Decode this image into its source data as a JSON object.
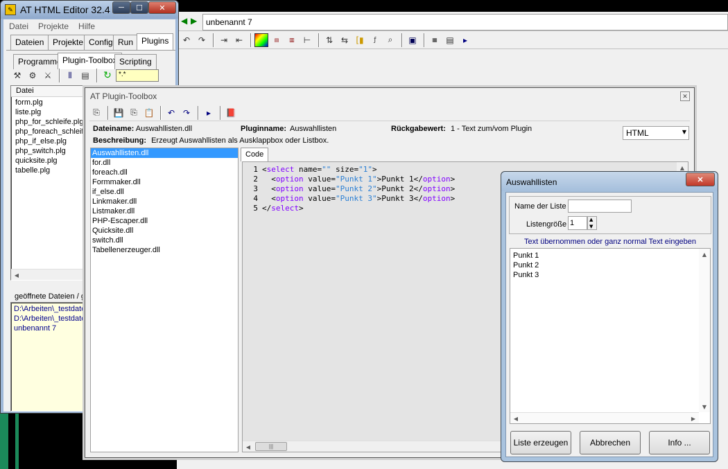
{
  "main_window": {
    "title": "AT HTML Editor 32.4",
    "menu": [
      "Datei",
      "Projekte",
      "Hilfe"
    ],
    "top_tabs": [
      "Dateien",
      "Projekte",
      "Config",
      "Run",
      "Plugins"
    ],
    "sub_tabs": [
      "Programme",
      "Plugin-Toolbox",
      "Scripting"
    ],
    "filter_value": "*.*",
    "file_column_header": "Datei",
    "files": [
      "form.plg",
      "liste.plg",
      "php_for_schleife.plg",
      "php_foreach_schleife",
      "php_if_else.plg",
      "php_switch.plg",
      "quicksite.plg",
      "tabelle.plg"
    ],
    "open_files_header": "geöffnete Dateien / g",
    "open_files": [
      "D:\\Arbeiten\\_testdaten",
      "D:\\Arbeiten\\_testdaten",
      "unbenannt 7"
    ]
  },
  "editor_bar": {
    "document_tab": "unbenannt 7",
    "icons": [
      "undo-icon",
      "redo-icon",
      "indent-icon",
      "outdent-icon",
      "color-picker-icon",
      "html-php-basic-icon",
      "code-icon",
      "tree-icon",
      "sort-icon",
      "replace-icon",
      "bracket-icon",
      "func-icon",
      "search-doc-icon",
      "window-icon",
      "asp-jsp-icon",
      "preview-icon",
      "run-icon"
    ]
  },
  "plugin_toolbox": {
    "title": "AT Plugin-Toolbox",
    "dateiname_label": "Dateiname:",
    "dateiname_value": "Auswahllisten.dll",
    "pluginname_label": "Pluginname:",
    "pluginname_value": "Auswahllisten",
    "rueckgabe_label": "Rückgabewert:",
    "rueckgabe_value": "1 - Text zum/vom Plugin",
    "format_value": "HTML",
    "beschreibung_label": "Beschreibung:",
    "beschreibung_value": "Erzeugt Auswahllisten als Ausklappbox oder Listbox.",
    "dlls": [
      "Auswahllisten.dll",
      "for.dll",
      "foreach.dll",
      "Formmaker.dll",
      "if_else.dll",
      "Linkmaker.dll",
      "Listmaker.dll",
      "PHP-Escaper.dll",
      "Quicksite.dll",
      "switch.dll",
      "Tabellenerzeuger.dll"
    ],
    "code_tab": "Code",
    "code_lines": [
      {
        "n": "1",
        "indent": "",
        "parts": [
          [
            "t",
            "<"
          ],
          [
            "k",
            "select"
          ],
          [
            "t",
            " name="
          ],
          [
            "s",
            "\"\""
          ],
          [
            "t",
            " size="
          ],
          [
            "s",
            "\"1\""
          ],
          [
            "t",
            ">"
          ]
        ]
      },
      {
        "n": "2",
        "indent": "  ",
        "parts": [
          [
            "t",
            "<"
          ],
          [
            "k",
            "option"
          ],
          [
            "t",
            " value="
          ],
          [
            "s",
            "\"Punkt 1\""
          ],
          [
            "t",
            ">Punkt 1</"
          ],
          [
            "k",
            "option"
          ],
          [
            "t",
            ">"
          ]
        ]
      },
      {
        "n": "3",
        "indent": "  ",
        "parts": [
          [
            "t",
            "<"
          ],
          [
            "k",
            "option"
          ],
          [
            "t",
            " value="
          ],
          [
            "s",
            "\"Punkt 2\""
          ],
          [
            "t",
            ">Punkt 2</"
          ],
          [
            "k",
            "option"
          ],
          [
            "t",
            ">"
          ]
        ]
      },
      {
        "n": "4",
        "indent": "  ",
        "parts": [
          [
            "t",
            "<"
          ],
          [
            "k",
            "option"
          ],
          [
            "t",
            " value="
          ],
          [
            "s",
            "\"Punkt 3\""
          ],
          [
            "t",
            ">Punkt 3</"
          ],
          [
            "k",
            "option"
          ],
          [
            "t",
            ">"
          ]
        ]
      },
      {
        "n": "5",
        "indent": "",
        "parts": [
          [
            "t",
            "</"
          ],
          [
            "k",
            "select"
          ],
          [
            "t",
            ">"
          ]
        ]
      }
    ]
  },
  "dialog": {
    "title": "Auswahllisten",
    "name_label": "Name der Liste",
    "name_value": "",
    "size_label": "Listengröße",
    "size_value": "1",
    "hint": "Text übernommen oder ganz normal Text eingeben",
    "text_lines": [
      "Punkt 1",
      "Punkt 2",
      "Punkt 3"
    ],
    "btn_create": "Liste erzeugen",
    "btn_cancel": "Abbrechen",
    "btn_info": "Info ..."
  },
  "colors": {
    "selection": "#3399ff",
    "keyword": "#8000ff",
    "string": "#2a7fd4",
    "dialog_hint": "#000080",
    "close_red": "#c74c3c"
  }
}
